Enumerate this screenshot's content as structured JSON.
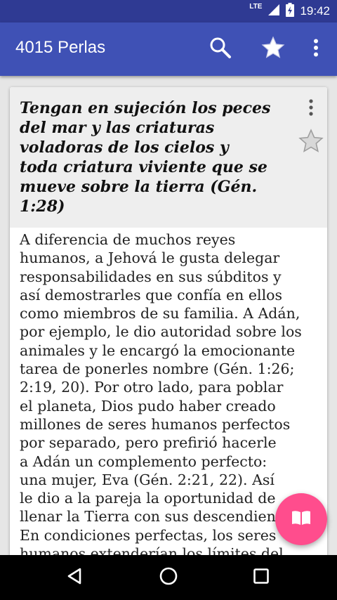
{
  "status_bar": {
    "network": "LTE",
    "time": "19:42"
  },
  "app_bar": {
    "title": "4015 Perlas",
    "icons": [
      "search-icon",
      "star-icon",
      "more-vert-icon"
    ]
  },
  "card": {
    "title": "Tengan en sujeción los peces\ndel mar y las criaturas\nvoladoras de los cielos y\ntoda criatura viviente que se\nmueve sobre la tierra (Gén.\n1:28)",
    "favorited": false,
    "body": "A diferencia de muchos reyes\nhumanos, a Jehová le gusta delegar\nresponsabilidades en sus súbditos y\nasí demostrarles que confía en ellos\ncomo miembros de su familia. A Adán,\npor ejemplo, le dio autoridad sobre los\nanimales y le encargó la emocionante\ntarea de ponerles nombre (Gén. 1:26;\n2:19, 20). Por otro lado, para poblar\nel planeta, Dios pudo haber creado\nmillones de seres humanos perfectos\npor separado, pero prefirió hacerle\na Adán un complemento perfecto:\nuna mujer, Eva (Gén. 2:21, 22). Así\nle dio a la pareja la oportunidad de\nllenar la Tierra con sus descendientes.\nEn condiciones perfectas, los seres\nhumanos extenderían los límites del"
  },
  "fab": {
    "icon": "open-book-icon"
  },
  "nav_bar": {
    "icons": [
      "back-icon",
      "home-icon",
      "recents-icon"
    ]
  },
  "colors": {
    "status_bar": "#2f3a93",
    "app_bar": "#3f51b5",
    "card_header": "#eeeeee",
    "fab": "#ff4d8d",
    "nav_bar": "#000000"
  }
}
